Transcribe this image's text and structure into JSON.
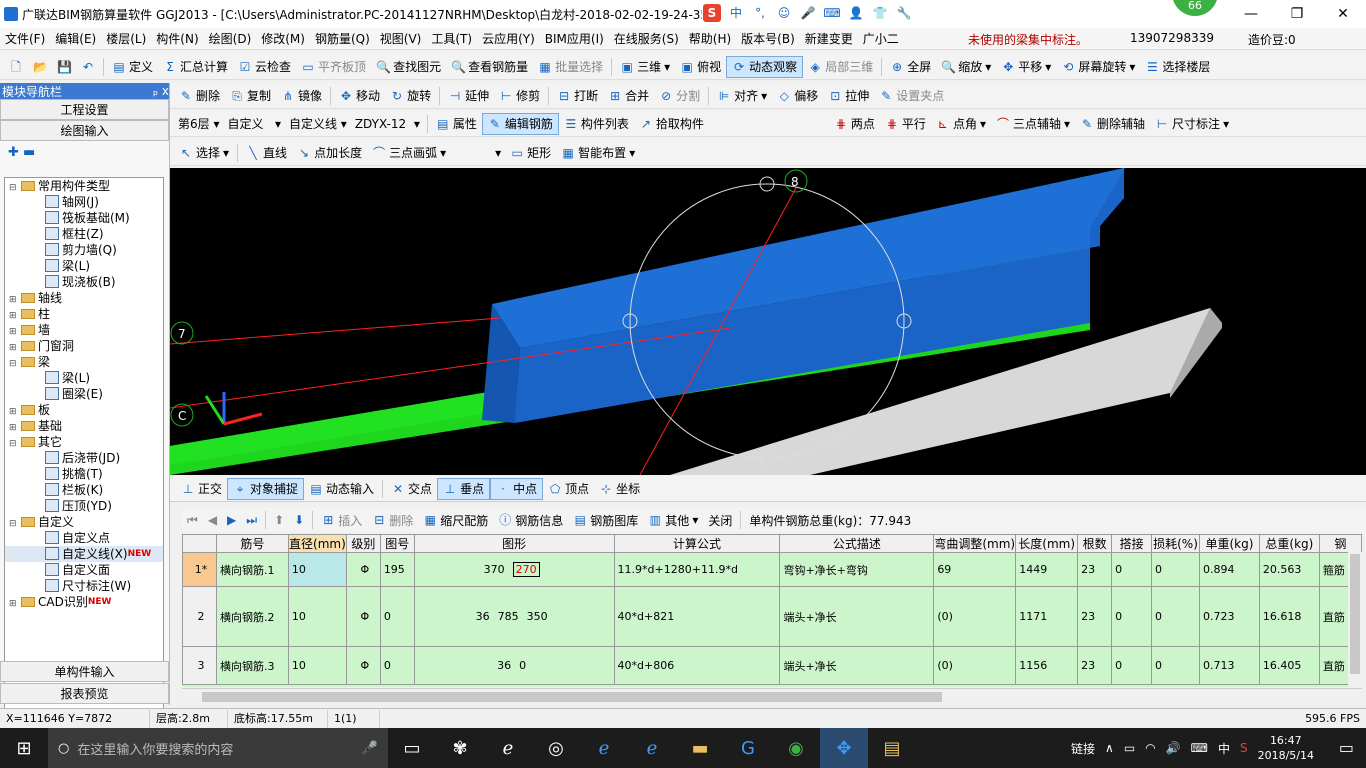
{
  "title_bar": {
    "title": "广联达BIM钢筋算量软件 GGJ2013 - [C:\\Users\\Administrator.PC-20141127NRHM\\Desktop\\白龙村-2018-02-02-19-24-35",
    "badge": "66",
    "ime": [
      "S",
      "中",
      "°,",
      "☺",
      "🎤",
      "⌨",
      "👤",
      "👕",
      "🔧"
    ]
  },
  "menu": {
    "items": [
      "文件(F)",
      "编辑(E)",
      "楼层(L)",
      "构件(N)",
      "绘图(D)",
      "修改(M)",
      "钢筋量(Q)",
      "视图(V)",
      "工具(T)",
      "云应用(Y)",
      "BIM应用(I)",
      "在线服务(S)",
      "帮助(H)",
      "版本号(B)",
      "新建变更",
      "广小二"
    ],
    "hint": "未使用的梁集中标注。",
    "phone": "13907298339",
    "cost": "造价豆:0"
  },
  "toolbar1": [
    "定义",
    "汇总计算",
    "云检查",
    "平齐板顶",
    "查找图元",
    "查看钢筋量",
    "批量选择",
    "三维",
    "俯视",
    "动态观察",
    "局部三维",
    "全屏",
    "缩放",
    "平移",
    "屏幕旋转",
    "选择楼层"
  ],
  "toolbar2": [
    "删除",
    "复制",
    "镜像",
    "移动",
    "旋转",
    "延伸",
    "修剪",
    "打断",
    "合并",
    "分割",
    "对齐",
    "偏移",
    "拉伸",
    "设置夹点"
  ],
  "toolbar3": {
    "floor": "第6层",
    "category": "自定义",
    "type": "自定义线",
    "element": "ZDYX-12",
    "buttons": [
      "属性",
      "编辑钢筋",
      "构件列表",
      "拾取构件"
    ],
    "axis_buttons": [
      "两点",
      "平行",
      "点角",
      "三点辅轴",
      "删除辅轴",
      "尺寸标注"
    ]
  },
  "toolbar4": [
    "选择",
    "直线",
    "点加长度",
    "三点画弧",
    "矩形",
    "智能布置"
  ],
  "sidebar": {
    "header": "模块导航栏",
    "pin": "ₚ x",
    "btn_project": "工程设置",
    "btn_draw": "绘图输入",
    "btn_single": "单构件输入",
    "btn_report": "报表预览",
    "tree": [
      {
        "level": 0,
        "toggle": "−",
        "folder": true,
        "label": "常用构件类型"
      },
      {
        "level": 1,
        "label": "轴网(J)"
      },
      {
        "level": 1,
        "label": "筏板基础(M)"
      },
      {
        "level": 1,
        "label": "框柱(Z)"
      },
      {
        "level": 1,
        "label": "剪力墙(Q)"
      },
      {
        "level": 1,
        "label": "梁(L)"
      },
      {
        "level": 1,
        "label": "现浇板(B)"
      },
      {
        "level": 0,
        "toggle": "+",
        "folder": true,
        "label": "轴线"
      },
      {
        "level": 0,
        "toggle": "+",
        "folder": true,
        "label": "柱"
      },
      {
        "level": 0,
        "toggle": "+",
        "folder": true,
        "label": "墙"
      },
      {
        "level": 0,
        "toggle": "+",
        "folder": true,
        "label": "门窗洞"
      },
      {
        "level": 0,
        "toggle": "−",
        "folder": true,
        "label": "梁"
      },
      {
        "level": 1,
        "label": "梁(L)"
      },
      {
        "level": 1,
        "label": "圈梁(E)"
      },
      {
        "level": 0,
        "toggle": "+",
        "folder": true,
        "label": "板"
      },
      {
        "level": 0,
        "toggle": "+",
        "folder": true,
        "label": "基础"
      },
      {
        "level": 0,
        "toggle": "−",
        "folder": true,
        "label": "其它"
      },
      {
        "level": 1,
        "label": "后浇带(JD)"
      },
      {
        "level": 1,
        "label": "挑檐(T)"
      },
      {
        "level": 1,
        "label": "栏板(K)"
      },
      {
        "level": 1,
        "label": "压顶(YD)"
      },
      {
        "level": 0,
        "toggle": "−",
        "folder": true,
        "label": "自定义"
      },
      {
        "level": 1,
        "label": "自定义点"
      },
      {
        "level": 1,
        "label": "自定义线(X)",
        "new": "NEW"
      },
      {
        "level": 1,
        "label": "自定义面"
      },
      {
        "level": 1,
        "label": "尺寸标注(W)"
      },
      {
        "level": 0,
        "toggle": "+",
        "folder": true,
        "label": "CAD识别",
        "new": "NEW"
      }
    ]
  },
  "viewport": {
    "axis_labels": [
      "8",
      "7",
      "C"
    ]
  },
  "snapbar": [
    "正交",
    "对象捕捉",
    "动态输入",
    "交点",
    "垂点",
    "中点",
    "顶点",
    "坐标"
  ],
  "gridbar": {
    "buttons": [
      "插入",
      "删除",
      "缩尺配筋",
      "钢筋信息",
      "钢筋图库",
      "其他",
      "关闭"
    ],
    "total": "单构件钢筋总重(kg)：77.943"
  },
  "table": {
    "headers": [
      "",
      "筋号",
      "直径(mm)",
      "级别",
      "图号",
      "图形",
      "计算公式",
      "公式描述",
      "弯曲调整(mm)",
      "长度(mm)",
      "根数",
      "搭接",
      "损耗(%)",
      "单重(kg)",
      "总重(kg)",
      "钢"
    ],
    "rows": [
      {
        "idx": "1*",
        "name": "横向钢筋.1",
        "dia": "10",
        "grade": "Φ",
        "fig": "195",
        "shape": [
          "370",
          "270"
        ],
        "formula": "11.9*d+1280+11.9*d",
        "desc": "弯钩+净长+弯钩",
        "bend": "69",
        "len": "1449",
        "count": "23",
        "lap": "0",
        "loss": "0",
        "unit": "0.894",
        "total": "20.563",
        "type": "箍筋"
      },
      {
        "idx": "2",
        "name": "横向钢筋.2",
        "dia": "10",
        "grade": "Φ",
        "fig": "0",
        "shape": [
          "36",
          "785",
          "350"
        ],
        "formula": "40*d+821",
        "desc": "端头+净长",
        "bend": "(0)",
        "len": "1171",
        "count": "23",
        "lap": "0",
        "loss": "0",
        "unit": "0.723",
        "total": "16.618",
        "type": "直筋"
      },
      {
        "idx": "3",
        "name": "横向钢筋.3",
        "dia": "10",
        "grade": "Φ",
        "fig": "0",
        "shape": [
          "36",
          "0"
        ],
        "formula": "40*d+806",
        "desc": "端头+净长",
        "bend": "(0)",
        "len": "1156",
        "count": "23",
        "lap": "0",
        "loss": "0",
        "unit": "0.713",
        "total": "16.405",
        "type": "直筋"
      }
    ]
  },
  "status": {
    "coords": "X=111646  Y=7872",
    "floor_height": "层高:2.8m",
    "base_height": "底标高:17.55m",
    "sel": "1(1)",
    "fps": "595.6 FPS"
  },
  "taskbar": {
    "search": "在这里输入你要搜索的内容",
    "tray_link": "链接",
    "ime": "中",
    "time": "16:47",
    "date": "2018/5/14"
  },
  "colors": {
    "blue_beam": "#1f6fd0",
    "green_beam": "#1ed61e",
    "grey_slab": "#d8d8d8",
    "grid_bg": "#ccf5cc"
  }
}
